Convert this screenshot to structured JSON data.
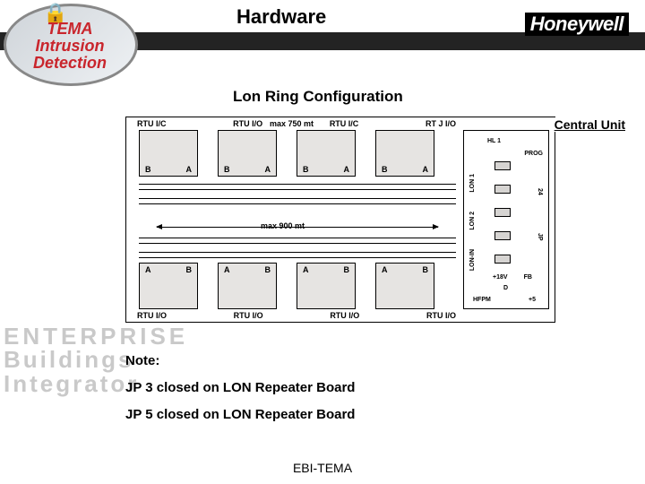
{
  "header": {
    "title": "Hardware",
    "brand": "Honeywell"
  },
  "logo": {
    "line1": "TEMA",
    "line2": "Intrusion",
    "line3": "Detection"
  },
  "subtitle": "Lon Ring Configuration",
  "diagram": {
    "central_label": "Central Unit",
    "max_top": "max 750 mt",
    "max_mid": "max 900 mt",
    "rtu_top": [
      "RTU I/C",
      "RTU I/O",
      "RTU I/C",
      "RT J I/O"
    ],
    "rtu_bottom": [
      "RTU I/O",
      "RTU I/O",
      "RTU I/O",
      "RTU I/O"
    ],
    "port_a": "A",
    "port_b": "B",
    "central_pins": {
      "hl1": "HL 1",
      "lon1": "LON 1",
      "lon2": "LON 2",
      "lonin": "LON-IN",
      "v24": "24",
      "jp": "JP",
      "prog": "PROG",
      "d": "D",
      "fb": "FB",
      "plus18v": "+18V",
      "plus5v": "+5",
      "hfpm": "HFPM"
    }
  },
  "notes": {
    "heading": "Note:",
    "line1": "JP 3 closed on LON Repeater Board",
    "line2": "JP 5 closed on LON Repeater Board"
  },
  "bg_watermark": {
    "l1": "ENTERPRISE",
    "l2": "Buildings",
    "l3": "Integrator"
  },
  "footer": "EBI-TEMA"
}
